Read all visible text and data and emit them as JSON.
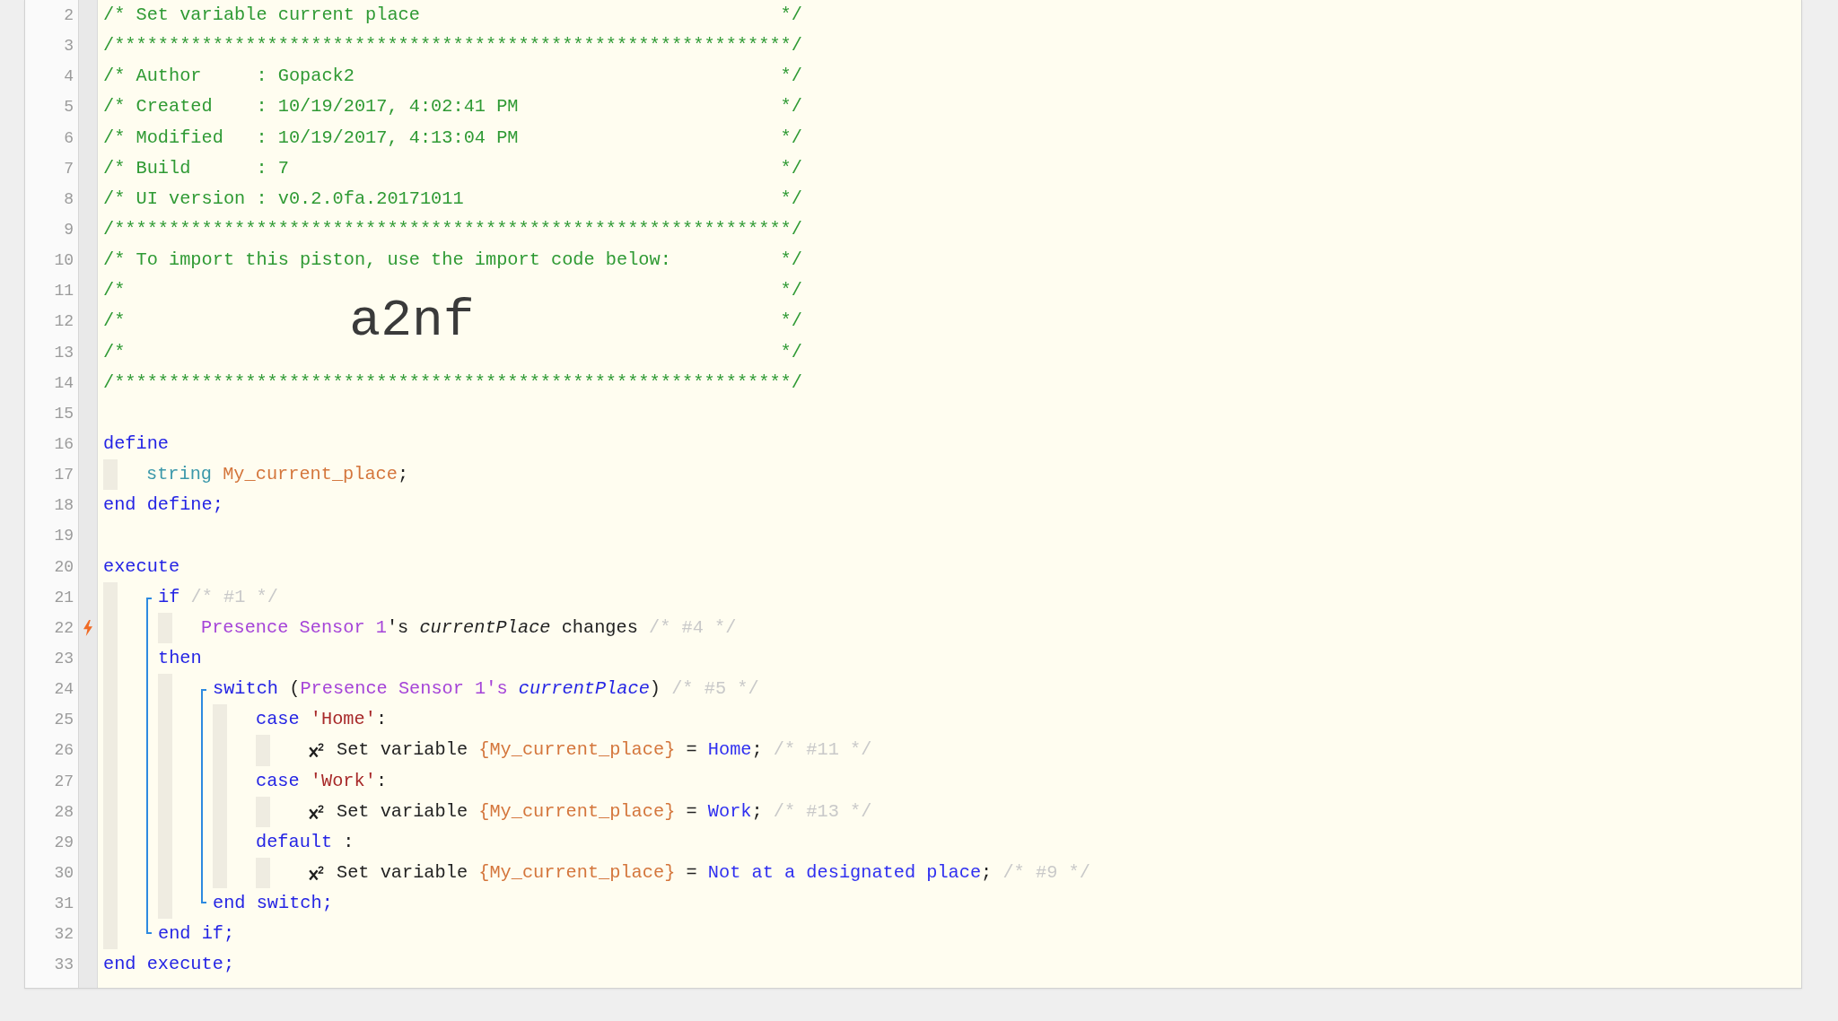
{
  "editor": {
    "lines": [
      {
        "kind": "banner",
        "number": "2",
        "text": "/* Set variable current place",
        "end": "*/"
      },
      {
        "kind": "banner",
        "number": "3",
        "text": "/**************************************************************/"
      },
      {
        "kind": "banner",
        "number": "4",
        "text": "/* Author     : Gopack2",
        "end": "*/"
      },
      {
        "kind": "banner",
        "number": "5",
        "text": "/* Created    : 10/19/2017, 4:02:41 PM",
        "end": "*/"
      },
      {
        "kind": "banner",
        "number": "6",
        "text": "/* Modified   : 10/19/2017, 4:13:04 PM",
        "end": "*/"
      },
      {
        "kind": "banner",
        "number": "7",
        "text": "/* Build      : 7",
        "end": "*/"
      },
      {
        "kind": "banner",
        "number": "8",
        "text": "/* UI version : v0.2.0fa.20171011",
        "end": "*/"
      },
      {
        "kind": "banner",
        "number": "9",
        "text": "/**************************************************************/"
      },
      {
        "kind": "banner",
        "number": "10",
        "text": "/* To import this piston, use the import code below:",
        "end": "*/"
      },
      {
        "kind": "banner",
        "number": "11",
        "text": "/*",
        "end": "*/"
      },
      {
        "kind": "banner",
        "number": "12",
        "text": "/*",
        "import_code": "a2nf",
        "end": "*/"
      },
      {
        "kind": "banner",
        "number": "13",
        "text": "/*",
        "end": "*/"
      },
      {
        "kind": "banner",
        "number": "14",
        "text": "/**************************************************************/"
      },
      {
        "kind": "line",
        "number": "15"
      },
      {
        "kind": "line",
        "number": "16",
        "tokens": [
          {
            "text": "define",
            "kind": "keyword"
          }
        ],
        "children": [
          {
            "kind": "line",
            "number": "17",
            "tokens": [
              {
                "text": "string ",
                "kind": "type"
              },
              {
                "text": "My_current_place",
                "kind": "variable"
              },
              {
                "text": ";",
                "kind": "plain"
              }
            ]
          }
        ]
      },
      {
        "kind": "line",
        "number": "18",
        "tokens": [
          {
            "text": "end define;",
            "kind": "keyword"
          }
        ]
      },
      {
        "kind": "line",
        "number": "19"
      },
      {
        "kind": "line",
        "number": "20",
        "tokens": [
          {
            "text": "execute",
            "kind": "keyword"
          }
        ],
        "children": [
          {
            "kind": "group",
            "lines": [
              {
                "kind": "line",
                "number": "21",
                "tokens": [
                  {
                    "text": "if ",
                    "kind": "keyword"
                  },
                  {
                    "text": "/* #1 */",
                    "kind": "remark"
                  }
                ],
                "children": [
                  {
                    "kind": "line",
                    "number": "22",
                    "trigger": true,
                    "tokens": [
                      {
                        "text": "Presence Sensor 1",
                        "kind": "device"
                      },
                      {
                        "text": "'s ",
                        "kind": "plain"
                      },
                      {
                        "text": "currentPlace",
                        "kind": "attribute"
                      },
                      {
                        "text": " changes ",
                        "kind": "plain"
                      },
                      {
                        "text": "/* #4 */",
                        "kind": "remark"
                      }
                    ]
                  }
                ]
              },
              {
                "kind": "line",
                "number": "23",
                "tokens": [
                  {
                    "text": "then",
                    "kind": "keyword"
                  }
                ],
                "children": [
                  {
                    "kind": "group",
                    "lines": [
                      {
                        "kind": "line",
                        "number": "24",
                        "tokens": [
                          {
                            "text": "switch",
                            "kind": "keyword"
                          },
                          {
                            "text": " (",
                            "kind": "plain"
                          },
                          {
                            "text": "Presence Sensor 1's ",
                            "kind": "device"
                          },
                          {
                            "text": "currentPlace",
                            "kind": "property"
                          },
                          {
                            "text": ") ",
                            "kind": "plain"
                          },
                          {
                            "text": "/* #5 */",
                            "kind": "remark"
                          }
                        ],
                        "children": [
                          {
                            "kind": "line",
                            "number": "25",
                            "tokens": [
                              {
                                "text": "case ",
                                "kind": "keyword"
                              },
                              {
                                "text": "'Home'",
                                "kind": "string"
                              },
                              {
                                "text": ":",
                                "kind": "plain"
                              }
                            ],
                            "children": [
                              {
                                "kind": "task",
                                "number": "26",
                                "tokens": [
                                  {
                                    "text": "Set variable ",
                                    "kind": "plain"
                                  },
                                  {
                                    "text": "{My_current_place}",
                                    "kind": "variable"
                                  },
                                  {
                                    "text": " = ",
                                    "kind": "plain"
                                  },
                                  {
                                    "text": "Home",
                                    "kind": "value"
                                  },
                                  {
                                    "text": "; ",
                                    "kind": "plain"
                                  },
                                  {
                                    "text": "/* #11 */",
                                    "kind": "remark"
                                  }
                                ]
                              }
                            ]
                          },
                          {
                            "kind": "line",
                            "number": "27",
                            "tokens": [
                              {
                                "text": "case ",
                                "kind": "keyword"
                              },
                              {
                                "text": "'Work'",
                                "kind": "string"
                              },
                              {
                                "text": ":",
                                "kind": "plain"
                              }
                            ],
                            "children": [
                              {
                                "kind": "task",
                                "number": "28",
                                "tokens": [
                                  {
                                    "text": "Set variable ",
                                    "kind": "plain"
                                  },
                                  {
                                    "text": "{My_current_place}",
                                    "kind": "variable"
                                  },
                                  {
                                    "text": " = ",
                                    "kind": "plain"
                                  },
                                  {
                                    "text": "Work",
                                    "kind": "value"
                                  },
                                  {
                                    "text": "; ",
                                    "kind": "plain"
                                  },
                                  {
                                    "text": "/* #13 */",
                                    "kind": "remark"
                                  }
                                ]
                              }
                            ]
                          },
                          {
                            "kind": "line",
                            "number": "29",
                            "tokens": [
                              {
                                "text": "default",
                                "kind": "keyword"
                              },
                              {
                                "text": " :",
                                "kind": "plain"
                              }
                            ],
                            "children": [
                              {
                                "kind": "task",
                                "number": "30",
                                "tokens": [
                                  {
                                    "text": "Set variable ",
                                    "kind": "plain"
                                  },
                                  {
                                    "text": "{My_current_place}",
                                    "kind": "variable"
                                  },
                                  {
                                    "text": " = ",
                                    "kind": "plain"
                                  },
                                  {
                                    "text": "Not at a designated place",
                                    "kind": "value"
                                  },
                                  {
                                    "text": "; ",
                                    "kind": "plain"
                                  },
                                  {
                                    "text": "/* #9 */",
                                    "kind": "remark"
                                  }
                                ]
                              }
                            ]
                          }
                        ]
                      },
                      {
                        "kind": "line",
                        "number": "31",
                        "tokens": [
                          {
                            "text": "end switch;",
                            "kind": "keyword"
                          }
                        ]
                      }
                    ]
                  }
                ]
              },
              {
                "kind": "line",
                "number": "32",
                "tokens": [
                  {
                    "text": "end if;",
                    "kind": "keyword"
                  }
                ]
              }
            ]
          }
        ]
      },
      {
        "kind": "line",
        "number": "33",
        "tokens": [
          {
            "text": "end execute;",
            "kind": "keyword"
          }
        ]
      }
    ]
  }
}
